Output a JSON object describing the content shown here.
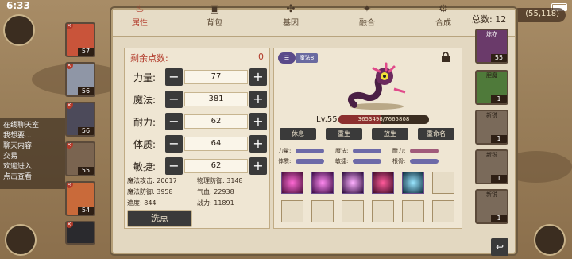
{
  "status": {
    "time": "6:33"
  },
  "currency": {
    "value": "55,118"
  },
  "chat": {
    "lines": [
      "在线聊天室",
      "我想要...",
      "聊天内容",
      "交易",
      "欢迎进入",
      "点击查看"
    ]
  },
  "tabs": [
    {
      "label": "属性",
      "icon": "flame-icon"
    },
    {
      "label": "背包",
      "icon": "backpack-icon"
    },
    {
      "label": "基因",
      "icon": "gene-icon"
    },
    {
      "label": "融合",
      "icon": "fusion-icon"
    },
    {
      "label": "合成",
      "icon": "craft-icon"
    }
  ],
  "total": {
    "label": "总数:",
    "value": "12"
  },
  "points": {
    "label": "剩余点数:",
    "value": "0"
  },
  "attributes": [
    {
      "name": "力量:",
      "value": "77"
    },
    {
      "name": "魔法:",
      "value": "381"
    },
    {
      "name": "耐力:",
      "value": "62"
    },
    {
      "name": "体质:",
      "value": "64"
    },
    {
      "name": "敏捷:",
      "value": "62"
    }
  ],
  "derived": [
    {
      "label": "魔法攻击:",
      "value": "20617"
    },
    {
      "label": "物理防御:",
      "value": "3148"
    },
    {
      "label": "魔法防御:",
      "value": "3958"
    },
    {
      "label": "气血:",
      "value": "22938"
    },
    {
      "label": "速度:",
      "value": "844"
    },
    {
      "label": "战力:",
      "value": "11891"
    }
  ],
  "wash_button": "洗点",
  "character": {
    "skin_label": "魔法8",
    "level": "Lv.55",
    "exp_text": "3653498/7665808",
    "exp_fraction": 0.4766
  },
  "actions": [
    "休息",
    "重生",
    "放生",
    "重命名"
  ],
  "growth": [
    {
      "label": "力量:"
    },
    {
      "label": "魔法:"
    },
    {
      "label": "耐力:"
    },
    {
      "label": "体质:"
    },
    {
      "label": "敏捷:"
    },
    {
      "label": "根骨:"
    }
  ],
  "heroes": [
    "57",
    "56",
    "56",
    "55",
    "54",
    ""
  ],
  "pets": [
    {
      "name": "炼亦",
      "lvl": "55"
    },
    {
      "name": "胆魔",
      "lvl": "1"
    },
    {
      "name": "新锐",
      "lvl": "1"
    },
    {
      "name": "新锐",
      "lvl": "1"
    },
    {
      "name": "新锐",
      "lvl": "1"
    }
  ],
  "colors": {
    "accent": "#b23a2a",
    "panel": "#e3d8c1",
    "button": "#3a3a3a"
  }
}
